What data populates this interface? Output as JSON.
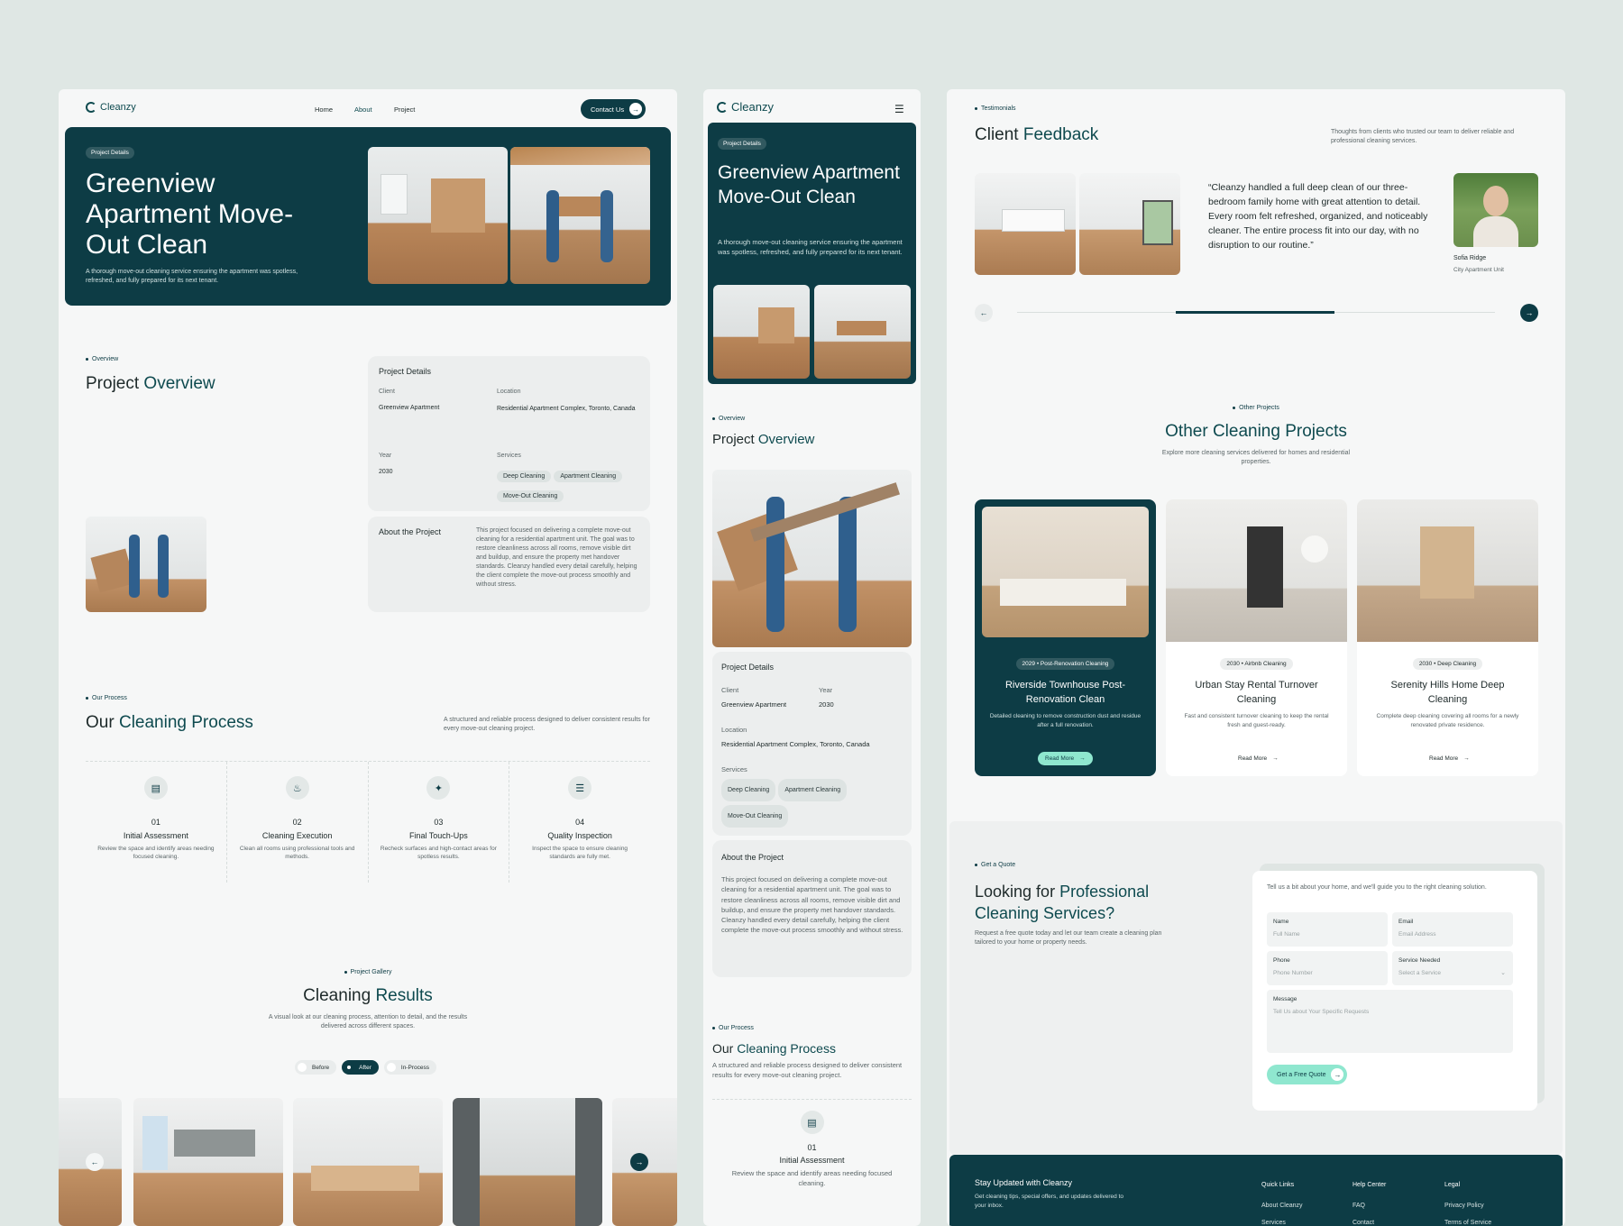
{
  "brand": {
    "name": "Cleanzy"
  },
  "desktop": {
    "nav": {
      "items": [
        "Home",
        "About",
        "Project"
      ],
      "cta": "Contact Us"
    },
    "hero": {
      "badge": "Project Details",
      "title": "Greenview Apartment Move-Out Clean",
      "desc": "A thorough move-out cleaning service ensuring the apartment was spotless, refreshed, and fully prepared for its next tenant."
    },
    "overview": {
      "label": "Overview",
      "title_a": "Project",
      "title_b": "Overview"
    },
    "details": {
      "title": "Project Details",
      "client_label": "Client",
      "client": "Greenview Apartment",
      "location_label": "Location",
      "location": "Residential Apartment Complex, Toronto, Canada",
      "year_label": "Year",
      "year": "2030",
      "services_label": "Services",
      "services": [
        "Deep Cleaning",
        "Apartment Cleaning",
        "Move-Out Cleaning"
      ]
    },
    "about": {
      "title": "About the Project",
      "text": "This project focused on delivering a complete move-out cleaning for a residential apartment unit. The goal was to restore cleanliness across all rooms, remove visible dirt and buildup, and ensure the property met handover standards. Cleanzy handled every detail carefully, helping the client complete the move-out process smoothly and without stress."
    },
    "process": {
      "label": "Our Process",
      "title_a": "Our",
      "title_b": "Cleaning Process",
      "desc": "A structured and reliable process designed to deliver consistent results for every move-out cleaning project.",
      "steps": [
        {
          "num": "01",
          "title": "Initial Assessment",
          "desc": "Review the space and identify areas needing focused cleaning.",
          "icon": "clipboard-icon"
        },
        {
          "num": "02",
          "title": "Cleaning Execution",
          "desc": "Clean all rooms using professional tools and methods.",
          "icon": "spray-icon"
        },
        {
          "num": "03",
          "title": "Final Touch-Ups",
          "desc": "Recheck surfaces and high-contact areas for spotless results.",
          "icon": "sparkle-icon"
        },
        {
          "num": "04",
          "title": "Quality Inspection",
          "desc": "Inspect the space to ensure cleaning standards are fully met.",
          "icon": "checklist-icon"
        }
      ]
    },
    "gallery": {
      "label": "Project Gallery",
      "title_a": "Cleaning",
      "title_b": "Results",
      "desc": "A visual look at our cleaning process, attention to detail, and the results delivered across different spaces.",
      "tabs": [
        "Before",
        "After",
        "In-Process"
      ],
      "active_tab": "After"
    }
  },
  "mobile": {
    "hero": {
      "badge": "Project Details",
      "title": "Greenview Apartment Move-Out Clean",
      "desc": "A thorough move-out cleaning service ensuring the apartment was spotless, refreshed, and fully prepared for its next tenant."
    },
    "overview": {
      "label": "Overview",
      "title_a": "Project",
      "title_b": "Overview"
    },
    "details": {
      "title": "Project Details",
      "client_label": "Client",
      "client": "Greenview Apartment",
      "year_label": "Year",
      "year": "2030",
      "location_label": "Location",
      "location": "Residential Apartment Complex, Toronto, Canada",
      "services_label": "Services",
      "services": [
        "Deep Cleaning",
        "Apartment Cleaning",
        "Move-Out Cleaning"
      ]
    },
    "about": {
      "title": "About the Project",
      "text": "This project focused on delivering a complete move-out cleaning for a residential apartment unit. The goal was to restore cleanliness across all rooms, remove visible dirt and buildup, and ensure the property met handover standards. Cleanzy handled every detail carefully, helping the client complete the move-out process smoothly and without stress."
    },
    "process": {
      "label": "Our Process",
      "title_a": "Our",
      "title_b": "Cleaning Process",
      "desc": "A structured and reliable process designed to deliver consistent results for every move-out cleaning project.",
      "step_num": "01",
      "step_title": "Initial Assessment",
      "step_desc": "Review the space and identify areas needing focused cleaning."
    }
  },
  "right": {
    "testimonials": {
      "label": "Testimonials",
      "title_a": "Client",
      "title_b": "Feedback",
      "desc": "Thoughts from clients who trusted our team to deliver reliable and professional cleaning services.",
      "quote": "“Cleanzy handled a full deep clean of our three-bedroom family home with great attention to detail. Every room felt refreshed, organized, and noticeably cleaner. The entire process fit into our day, with no disruption to our routine.”",
      "author": "Sofia Ridge",
      "role": "City Apartment Unit"
    },
    "other": {
      "label": "Other Projects",
      "title_a": "Other Cleaning",
      "title_b": "Projects",
      "desc": "Explore more cleaning services delivered for homes and residential properties.",
      "cards": [
        {
          "year": "2029",
          "cat": "Post-Renovation Cleaning",
          "title": "Riverside Townhouse Post-Renovation Clean",
          "desc": "Detailed cleaning to remove construction dust and residue after a full renovation.",
          "cta": "Read More"
        },
        {
          "year": "2030",
          "cat": "Airbnb Cleaning",
          "title": "Urban Stay Rental Turnover Cleaning",
          "desc": "Fast and consistent turnover cleaning to keep the rental fresh and guest-ready.",
          "cta": "Read More"
        },
        {
          "year": "2030",
          "cat": "Deep Cleaning",
          "title": "Serenity Hills Home Deep Cleaning",
          "desc": "Complete deep cleaning covering all rooms for a newly renovated private residence.",
          "cta": "Read More"
        }
      ]
    },
    "quote": {
      "label": "Get a Quote",
      "title_a": "Looking for",
      "title_b": "Professional Cleaning Services?",
      "desc": "Request a free quote today and let our team create a cleaning plan tailored to your home or property needs.",
      "form_intro": "Tell us a bit about your home, and we'll guide you to the right cleaning solution.",
      "name_label": "Name",
      "name_ph": "Full Name",
      "email_label": "Email",
      "email_ph": "Email Address",
      "phone_label": "Phone",
      "phone_ph": "Phone Number",
      "service_label": "Service Needed",
      "service_ph": "Select a Service",
      "message_label": "Message",
      "message_ph": "Tell Us about Your Specific Requests",
      "cta": "Get a Free Quote"
    },
    "footer": {
      "title": "Stay Updated with Cleanzy",
      "desc": "Get cleaning tips, special offers, and updates delivered to your inbox.",
      "quick_title": "Quick Links",
      "quick": [
        "About Cleanzy",
        "Services"
      ],
      "help_title": "Help Center",
      "help": [
        "FAQ",
        "Contact"
      ],
      "legal_title": "Legal",
      "legal": [
        "Privacy Policy",
        "Terms of Service"
      ]
    }
  }
}
